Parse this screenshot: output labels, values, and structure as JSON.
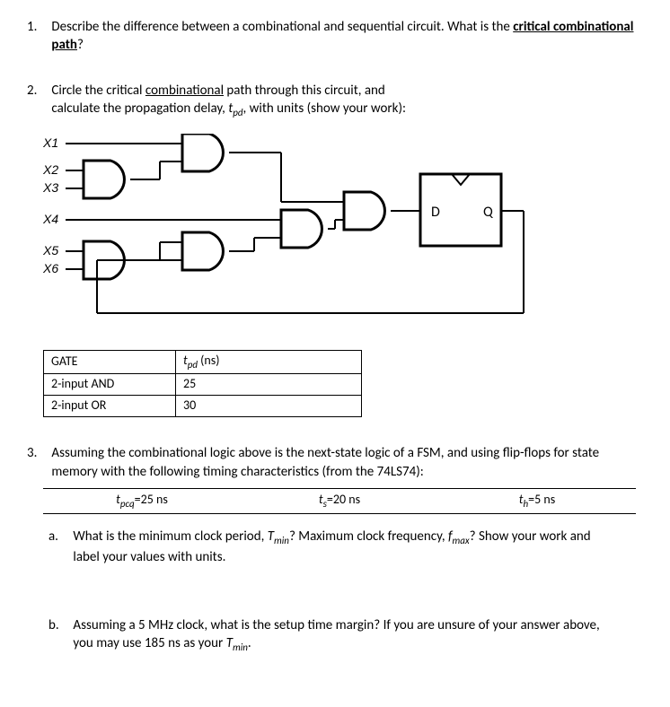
{
  "q1": {
    "num": "1.",
    "text_a": "Describe the difference between a combinational and sequential circuit. What is the ",
    "text_b": "critical combinational path",
    "text_c": "?"
  },
  "q2": {
    "num": "2.",
    "line1_a": "Circle the critical ",
    "line1_b": "combinational",
    "line1_c": " path through this circuit, and",
    "line2_a": "calculate the propagation delay, ",
    "line2_var": "t",
    "line2_sub": "pd",
    "line2_b": ", with units (show your work):",
    "inputs": {
      "x1": "X1",
      "x2": "X2",
      "x3": "X3",
      "x4": "X4",
      "x5": "X5",
      "x6": "X6"
    },
    "ff": {
      "d": "D",
      "q": "Q"
    },
    "table": {
      "h1": "GATE",
      "h2a": "t",
      "h2b": "pd",
      "h2c": " (ns)",
      "r1c1": "2-input AND",
      "r1c2": "25",
      "r2c1": "2-input OR",
      "r2c2": "30"
    }
  },
  "q3": {
    "num": "3.",
    "intro": "Assuming the combinational logic above is the next-state logic of a FSM, and using flip-flops for state memory with the following timing characteristics (from the 74LS74):",
    "timing": {
      "c1a": "t",
      "c1b": "pcq",
      "c1c": "=25 ns",
      "c2a": "t",
      "c2b": "s",
      "c2c": "=20 ns",
      "c3a": "t",
      "c3b": "h",
      "c3c": "=5 ns"
    },
    "a": {
      "num": "a.",
      "t1": "What is the minimum clock period, ",
      "t2v": "T",
      "t2s": "min",
      "t3": "? Maximum clock frequency, ",
      "t4v": "f",
      "t4s": "max",
      "t5": "? Show your work and label your values with units."
    },
    "b": {
      "num": "b.",
      "t1": "Assuming a 5 MHz clock, what is the setup time margin? If you are unsure of your answer above, you may use 185 ns as your ",
      "t2v": "T",
      "t2s": "min",
      "t3": "."
    }
  }
}
